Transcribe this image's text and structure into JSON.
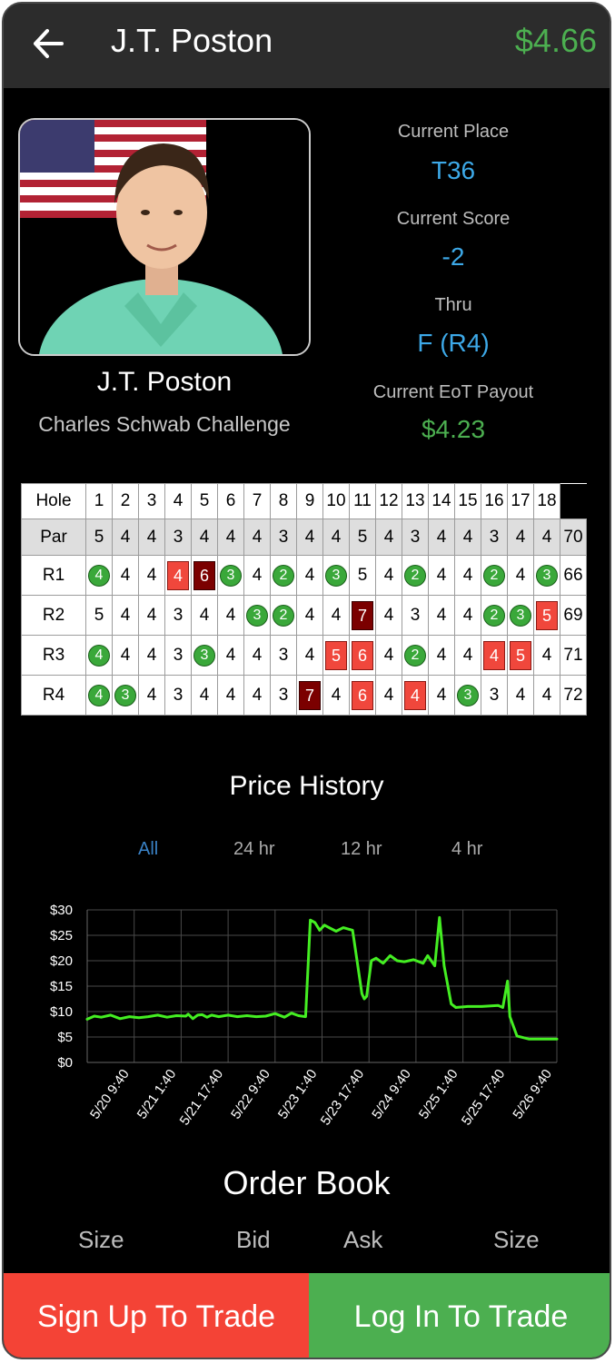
{
  "header": {
    "title": "J.T. Poston",
    "price": "$4.66"
  },
  "player": {
    "name": "J.T. Poston",
    "event": "Charles Schwab Challenge"
  },
  "stats": [
    {
      "label": "Current Place",
      "value": "T36"
    },
    {
      "label": "Current Score",
      "value": "-2"
    },
    {
      "label": "Thru",
      "value": "F (R4)"
    },
    {
      "label": "Current EoT Payout",
      "value": "$4.23"
    }
  ],
  "scorecard": {
    "hole_label": "Hole",
    "holes": [
      "1",
      "2",
      "3",
      "4",
      "5",
      "6",
      "7",
      "8",
      "9",
      "10",
      "11",
      "12",
      "13",
      "14",
      "15",
      "16",
      "17",
      "18"
    ],
    "par_label": "Par",
    "par": [
      "5",
      "4",
      "4",
      "3",
      "4",
      "4",
      "4",
      "3",
      "4",
      "4",
      "5",
      "4",
      "3",
      "4",
      "4",
      "3",
      "4",
      "4"
    ],
    "par_total": "70",
    "rounds": [
      {
        "label": "R1",
        "scores": [
          "4",
          "4",
          "4",
          "4",
          "6",
          "3",
          "4",
          "2",
          "4",
          "3",
          "5",
          "4",
          "2",
          "4",
          "4",
          "2",
          "4",
          "3"
        ],
        "total": "66"
      },
      {
        "label": "R2",
        "scores": [
          "5",
          "4",
          "4",
          "3",
          "4",
          "4",
          "3",
          "2",
          "4",
          "4",
          "7",
          "4",
          "3",
          "4",
          "4",
          "2",
          "3",
          "5"
        ],
        "total": "69"
      },
      {
        "label": "R3",
        "scores": [
          "4",
          "4",
          "4",
          "3",
          "3",
          "4",
          "4",
          "3",
          "4",
          "5",
          "6",
          "4",
          "2",
          "4",
          "4",
          "4",
          "5",
          "4"
        ],
        "total": "71"
      },
      {
        "label": "R4",
        "scores": [
          "4",
          "3",
          "4",
          "3",
          "4",
          "4",
          "4",
          "3",
          "7",
          "4",
          "6",
          "4",
          "4",
          "4",
          "3",
          "3",
          "4",
          "4"
        ],
        "total": "72"
      }
    ]
  },
  "price_history": {
    "title": "Price History",
    "tabs": [
      {
        "label": "All",
        "active": true
      },
      {
        "label": "24 hr"
      },
      {
        "label": "12 hr"
      },
      {
        "label": "4 hr"
      }
    ]
  },
  "chart_data": {
    "type": "line",
    "line_color": "#44ee22",
    "ylim": [
      0,
      30
    ],
    "yticks": [
      "$0",
      "$5",
      "$10",
      "$15",
      "$20",
      "$25",
      "$30"
    ],
    "xticks": [
      "5/20 9:40",
      "5/21 1:40",
      "5/21 17:40",
      "5/22 9:40",
      "5/23 1:40",
      "5/23 17:40",
      "5/24 9:40",
      "5/25 1:40",
      "5/25 17:40",
      "5/26 9:40"
    ],
    "x_range": [
      -0.9,
      9.1
    ],
    "x": [
      -0.9,
      -0.75,
      -0.6,
      -0.4,
      -0.2,
      0,
      0.2,
      0.4,
      0.6,
      0.8,
      1.0,
      1.2,
      1.25,
      1.35,
      1.45,
      1.55,
      1.65,
      1.75,
      1.9,
      2.1,
      2.3,
      2.5,
      2.7,
      2.9,
      3.1,
      3.3,
      3.45,
      3.6,
      3.75,
      3.85,
      3.95,
      4.05,
      4.15,
      4.25,
      4.4,
      4.55,
      4.75,
      4.95,
      5.0,
      5.05,
      5.15,
      5.25,
      5.4,
      5.55,
      5.7,
      5.85,
      6.05,
      6.25,
      6.35,
      6.5,
      6.6,
      6.7,
      6.85,
      6.95,
      7.2,
      7.5,
      7.85,
      7.95,
      8.05,
      8.1,
      8.25,
      8.5,
      8.8,
      9.1
    ],
    "y": [
      8.5,
      9.1,
      8.9,
      9.3,
      8.6,
      9.0,
      8.8,
      9.0,
      9.3,
      8.9,
      9.2,
      9.1,
      9.5,
      8.6,
      9.3,
      9.4,
      8.9,
      9.3,
      9.0,
      9.3,
      9.0,
      9.2,
      9.0,
      9.1,
      9.6,
      8.9,
      9.7,
      9.2,
      9.0,
      28.0,
      27.5,
      26.0,
      27.0,
      26.5,
      25.8,
      26.5,
      26.0,
      13.5,
      12.5,
      13.0,
      20.0,
      20.5,
      19.5,
      21.0,
      20.0,
      19.8,
      20.2,
      19.5,
      21.0,
      19.0,
      28.5,
      19.0,
      11.5,
      10.8,
      11.0,
      11.0,
      11.2,
      10.8,
      16.0,
      9.0,
      5.2,
      4.6,
      4.6,
      4.6
    ]
  },
  "order_book": {
    "title": "Order Book",
    "headers": [
      "Size",
      "Bid",
      "Ask",
      "Size"
    ]
  },
  "actions": {
    "signup": "Sign Up To Trade",
    "login": "Log In To Trade"
  }
}
